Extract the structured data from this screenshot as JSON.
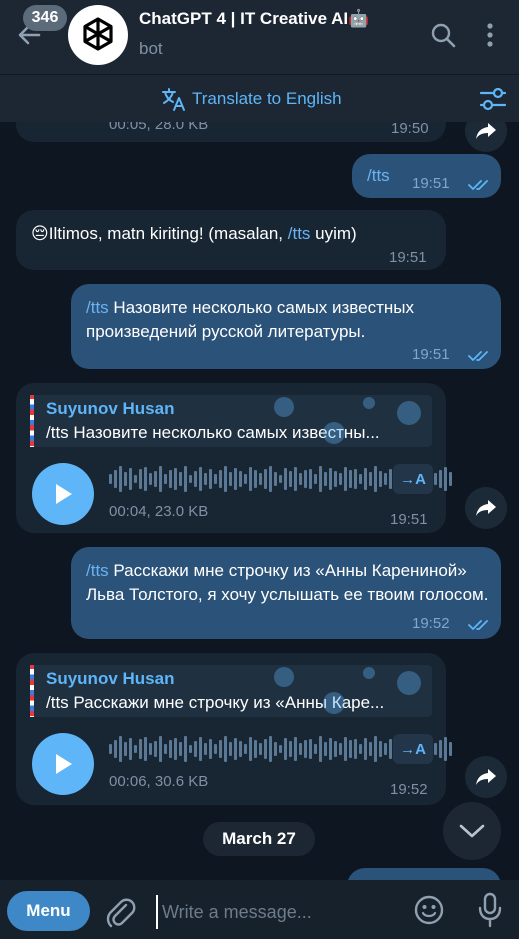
{
  "header": {
    "unread_count": "346",
    "title": "ChatGPT 4 | IT Creative AI🤖",
    "subtitle": "bot"
  },
  "translate_bar": {
    "label": "Translate to English"
  },
  "messages": {
    "m0_time": "19:50",
    "m0_meta": "00:05, 28.0 KB",
    "m1_text": "/tts",
    "m1_time": "19:51",
    "m2_emoji": "😔",
    "m2_text_a": "Iltimos, matn kiriting! (masalan, ",
    "m2_link": "/tts",
    "m2_text_b": " uyim)",
    "m2_time": "19:51",
    "m3_link": "/tts",
    "m3_text": " Назовите несколько самых известных произведений русской литературы.",
    "m3_time": "19:51",
    "m4_reply_name": "Suyunov Husan",
    "m4_reply_text": "/tts Назовите несколько самых известны...",
    "m4_meta": "00:04, 23.0 KB",
    "m4_transcribe": "→A",
    "m4_time": "19:51",
    "m5_link": "/tts",
    "m5_text": " Расскажи мне строчку из «Анны Карениной» Льва Толстого, я хочу услышать ее твоим голосом.",
    "m5_time": "19:52",
    "m6_reply_name": "Suyunov Husan",
    "m6_reply_text": "/tts Расскажи мне строчку из «Анны Каре...",
    "m6_meta": "00:06, 30.6 KB",
    "m6_transcribe": "→A",
    "m6_time": "19:52"
  },
  "date_separator": "March 27",
  "input_bar": {
    "menu_label": "Menu",
    "placeholder": "Write a message..."
  },
  "colors": {
    "accent": "#5eb5f7",
    "incoming_bubble": "#182533",
    "outgoing_bubble": "#2b5278",
    "background": "#0e1621"
  },
  "icons": [
    "back-arrow-icon",
    "search-icon",
    "more-vertical-icon",
    "translate-icon",
    "filter-icon",
    "play-icon",
    "share-icon",
    "chevron-down-icon",
    "paperclip-icon",
    "emoji-icon",
    "microphone-icon",
    "double-check-icon"
  ]
}
